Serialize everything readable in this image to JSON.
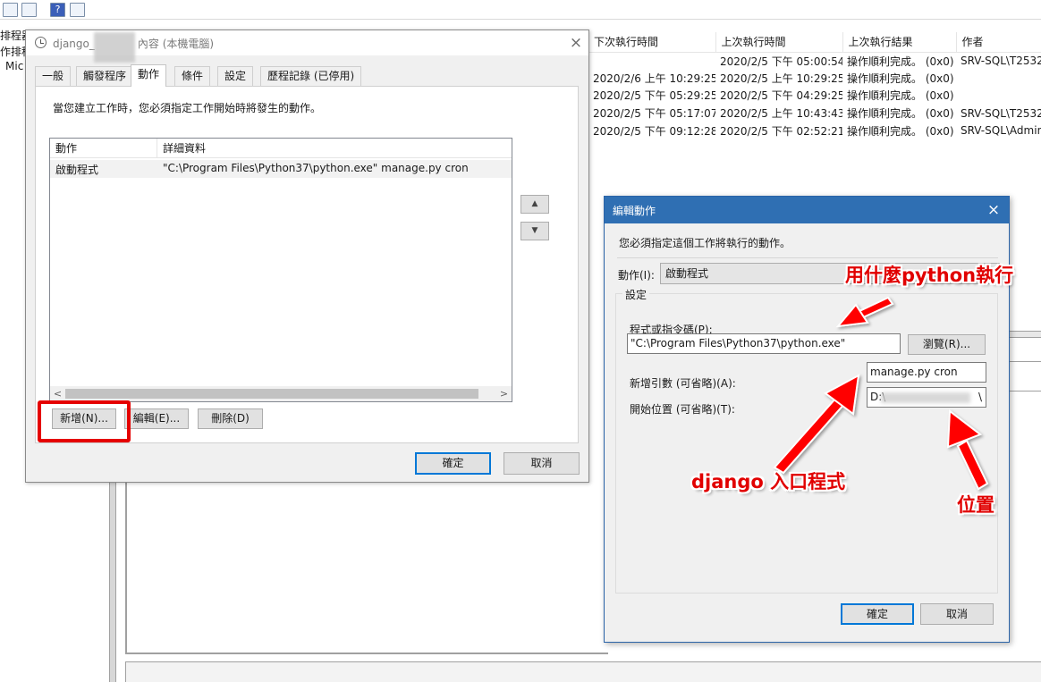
{
  "background_app": {
    "tree_items": [
      "排程器",
      "作排程",
      "Mic"
    ],
    "task_table": {
      "columns": [
        "下次執行時間",
        "上次執行時間",
        "上次執行結果",
        "作者"
      ],
      "rows": [
        [
          "",
          "2020/2/5 下午 05:00:54",
          "操作順利完成。 (0x0)",
          "SRV-SQL\\T2532"
        ],
        [
          "2020/2/6 上午 10:29:25",
          "2020/2/5 上午 10:29:25",
          "操作順利完成。 (0x0)",
          ""
        ],
        [
          "2020/2/5 下午 05:29:25",
          "2020/2/5 下午 04:29:25",
          "操作順利完成。 (0x0)",
          ""
        ],
        [
          "2020/2/5 下午 05:17:07",
          "2020/2/5 上午 10:43:43",
          "操作順利完成。 (0x0)",
          "SRV-SQL\\T2532"
        ],
        [
          "2020/2/5 下午 09:12:28",
          "2020/2/5 下午 02:52:21",
          "操作順利完成。 (0x0)",
          "SRV-SQL\\Admin"
        ]
      ]
    }
  },
  "properties_dialog": {
    "title_prefix": "django_",
    "title_suffix": "內容 (本機電腦)",
    "close_icon": "×",
    "tabs": [
      "一般",
      "觸發程序",
      "動作",
      "條件",
      "設定",
      "歷程記錄 (已停用)"
    ],
    "active_tab": "動作",
    "description": "當您建立工作時，您必須指定工作開始時將發生的動作。",
    "list_columns": [
      "動作",
      "詳細資料"
    ],
    "actions": [
      {
        "action": "啟動程式",
        "details": "\"C:\\Program Files\\Python37\\python.exe\" manage.py cron"
      }
    ],
    "move_up_icon": "▲",
    "move_down_icon": "▼",
    "scroll_left_icon": "<",
    "scroll_right_icon": ">",
    "buttons": {
      "new": "新增(N)...",
      "edit": "編輯(E)...",
      "delete": "刪除(D)",
      "ok": "確定",
      "cancel": "取消"
    }
  },
  "edit_action_dialog": {
    "title": "編輯動作",
    "close_icon": "×",
    "description": "您必須指定這個工作將執行的動作。",
    "action_label": "動作(I):",
    "action_value": "啟動程式",
    "settings_legend": "設定",
    "program_label": "程式或指令碼(P):",
    "program_value": "\"C:\\Program Files\\Python37\\python.exe\"",
    "browse_button": "瀏覽(R)...",
    "arguments_label": "新增引數 (可省略)(A):",
    "arguments_value": "manage.py cron",
    "start_in_label": "開始位置 (可省略)(T):",
    "start_in_prefix": "D:\\",
    "start_in_suffix": "\\",
    "ok_button": "確定",
    "cancel_button": "取消"
  },
  "annotations": {
    "python_label": "用什麼python執行",
    "entry_label": "django 入口程式",
    "location_label": "位置",
    "color": "#e10000"
  },
  "colors": {
    "dialog_title_bar": "#2f6fb3",
    "highlight": "#e50000",
    "default_button_border": "#0078d7"
  }
}
